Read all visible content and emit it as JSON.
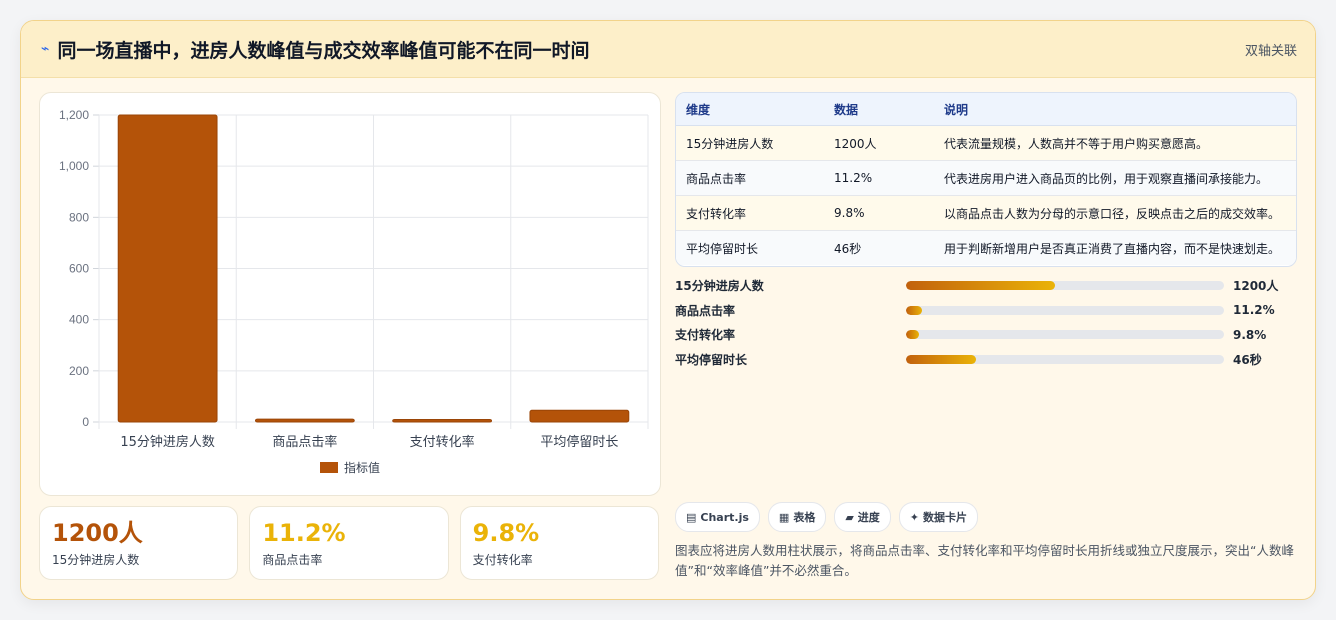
{
  "header": {
    "icon": "pulse-icon",
    "title": "同一场直播中，进房人数峰值与成交效率峰值可能不在同一时间",
    "tag": "双轴关联"
  },
  "chart_data": {
    "type": "bar",
    "categories": [
      "15分钟进房人数",
      "商品点击率",
      "支付转化率",
      "平均停留时长"
    ],
    "series": [
      {
        "name": "指标值",
        "values": [
          1200,
          11.2,
          9.8,
          46
        ],
        "color": "#b45309"
      }
    ],
    "yticks": [
      "0",
      "200",
      "400",
      "600",
      "800",
      "1,000",
      "1,200"
    ],
    "ylim": [
      0,
      1200
    ],
    "grid": true,
    "legend": "bottom"
  },
  "stats": [
    {
      "value": "1200人",
      "label": "15分钟进房人数",
      "color": "#b45309"
    },
    {
      "value": "11.2%",
      "label": "商品点击率",
      "color": "#eab308"
    },
    {
      "value": "9.8%",
      "label": "支付转化率",
      "color": "#eab308"
    }
  ],
  "table": {
    "headers": [
      "维度",
      "数据",
      "说明"
    ],
    "rows": [
      [
        "15分钟进房人数",
        "1200人",
        "代表流量规模，人数高并不等于用户购买意愿高。"
      ],
      [
        "商品点击率",
        "11.2%",
        "代表进房用户进入商品页的比例，用于观察直播间承接能力。"
      ],
      [
        "支付转化率",
        "9.8%",
        "以商品点击人数为分母的示意口径，反映点击之后的成交效率。"
      ],
      [
        "平均停留时长",
        "46秒",
        "用于判断新增用户是否真正消费了直播内容，而不是快速划走。"
      ]
    ]
  },
  "progress": [
    {
      "label": "15分钟进房人数",
      "value": "1200人",
      "fraction": 0.47
    },
    {
      "label": "商品点击率",
      "value": "11.2%",
      "fraction": 0.05
    },
    {
      "label": "支付转化率",
      "value": "9.8%",
      "fraction": 0.04
    },
    {
      "label": "平均停留时长",
      "value": "46秒",
      "fraction": 0.22
    }
  ],
  "chips": [
    {
      "icon": "chart-icon",
      "glyph": "▤",
      "label": "Chart.js"
    },
    {
      "icon": "table-icon",
      "glyph": "▦",
      "label": "表格"
    },
    {
      "icon": "progress-icon",
      "glyph": "▰",
      "label": "进度"
    },
    {
      "icon": "sparkle-icon",
      "glyph": "✦",
      "label": "数据卡片"
    }
  ],
  "note": "图表应将进房人数用柱状展示，将商品点击率、支付转化率和平均停留时长用折线或独立尺度展示，突出“人数峰值”和“效率峰值”并不必然重合。"
}
